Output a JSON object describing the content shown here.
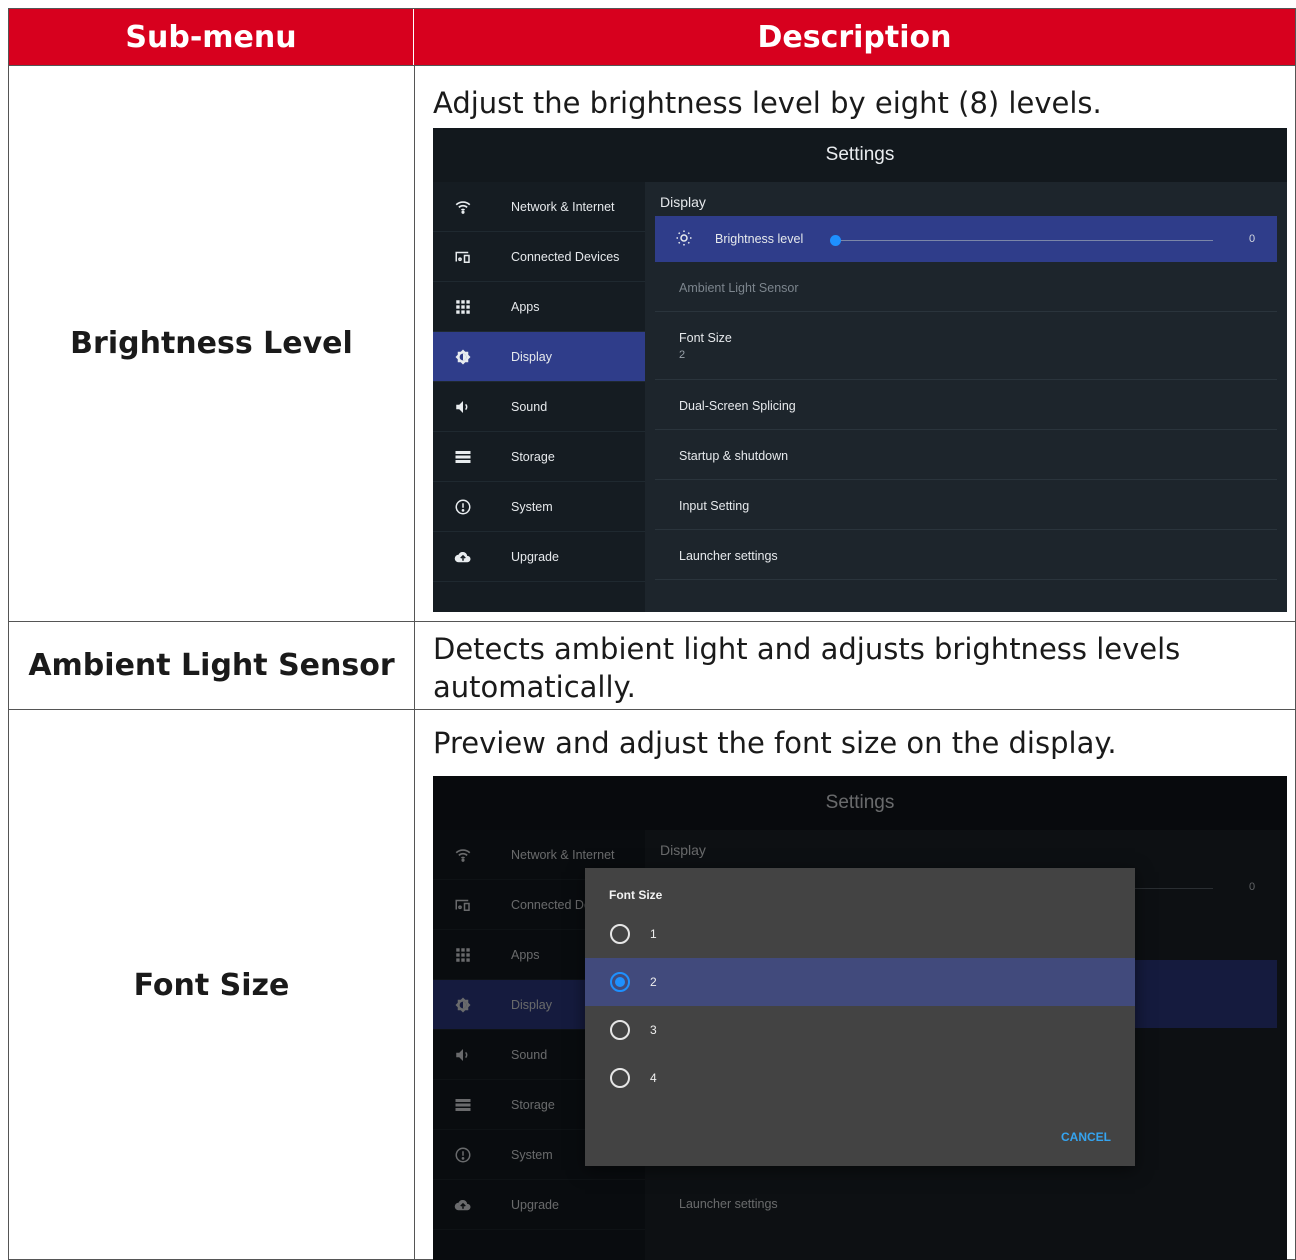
{
  "table": {
    "header": {
      "submenu": "Sub-menu",
      "description": "Description"
    },
    "rows": [
      {
        "name": "Brightness Level",
        "description": "Adjust the brightness level by eight (8) levels."
      },
      {
        "name": "Ambient Light Sensor",
        "description": "Detects ambient light and adjusts brightness levels automatically."
      },
      {
        "name": "Font Size",
        "description": "Preview and adjust the font size on the display."
      }
    ]
  },
  "settings": {
    "title": "Settings",
    "nav": [
      {
        "label": "Network & Internet",
        "icon": "wifi-icon"
      },
      {
        "label": "Connected Devices",
        "icon": "devices-icon"
      },
      {
        "label": "Apps",
        "icon": "apps-grid-icon"
      },
      {
        "label": "Display",
        "icon": "display-brightness-icon"
      },
      {
        "label": "Sound",
        "icon": "speaker-icon"
      },
      {
        "label": "Storage",
        "icon": "storage-icon"
      },
      {
        "label": "System",
        "icon": "info-circle-icon"
      },
      {
        "label": "Upgrade",
        "icon": "cloud-upload-icon"
      }
    ],
    "active_nav": "Display",
    "section": "Display",
    "brightness": {
      "label": "Brightness level",
      "value": "0",
      "icon": "sun-icon"
    },
    "items": {
      "ambient": "Ambient Light Sensor",
      "font_size": "Font Size",
      "font_size_value": "2",
      "dual_screen": "Dual-Screen Splicing",
      "startup": "Startup & shutdown",
      "input": "Input Setting",
      "launcher": "Launcher settings"
    }
  },
  "dialog": {
    "title": "Font Size",
    "options": [
      "1",
      "2",
      "3",
      "4"
    ],
    "selected": "2",
    "cancel": "CANCEL"
  },
  "colors": {
    "header_red": "#d7001e",
    "nav_active": "#2f3d8a",
    "accent_blue": "#1e90ff"
  }
}
